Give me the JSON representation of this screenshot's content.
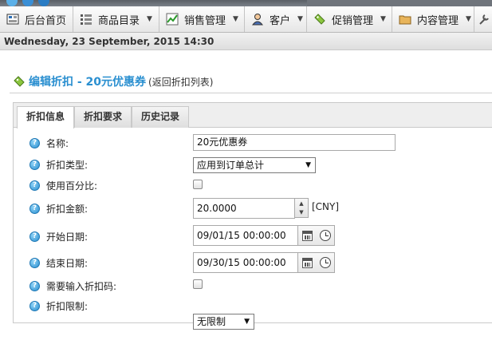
{
  "nav": {
    "items": [
      {
        "label": "后台首页",
        "icon": "dashboard-icon",
        "caret": false
      },
      {
        "label": "商品目录",
        "icon": "catalog-list-icon",
        "caret": true
      },
      {
        "label": "销售管理",
        "icon": "sales-chart-icon",
        "caret": true
      },
      {
        "label": "客户",
        "icon": "customer-person-icon",
        "caret": true
      },
      {
        "label": "促销管理",
        "icon": "promotion-tag-icon",
        "caret": true
      },
      {
        "label": "内容管理",
        "icon": "content-folder-icon",
        "caret": true
      }
    ],
    "caret_glyph": "▼"
  },
  "datebar": {
    "text": "Wednesday, 23 September, 2015 14:30"
  },
  "heading": {
    "title": "编辑折扣 - 20元优惠券",
    "back_link": "(返回折扣列表)"
  },
  "tabs": [
    {
      "label": "折扣信息",
      "active": true
    },
    {
      "label": "折扣要求",
      "active": false
    },
    {
      "label": "历史记录",
      "active": false
    }
  ],
  "form": {
    "name": {
      "label": "名称:",
      "value": "20元优惠券"
    },
    "discount_type": {
      "label": "折扣类型:",
      "value": "应用到订单总计"
    },
    "use_percentage": {
      "label": "使用百分比:",
      "checked": false
    },
    "amount": {
      "label": "折扣金额:",
      "value": "20.0000",
      "currency": "[CNY]"
    },
    "start_date": {
      "label": "开始日期:",
      "value": "09/01/15 00:00:00"
    },
    "end_date": {
      "label": "结束日期:",
      "value": "09/30/15 00:00:00"
    },
    "requires_code": {
      "label": "需要输入折扣码:",
      "checked": false
    },
    "limitation": {
      "label": "折扣限制:",
      "value": "无限制"
    }
  },
  "colors": {
    "accent": "#2a8fd0",
    "help_icon": "#2b8fd0"
  }
}
